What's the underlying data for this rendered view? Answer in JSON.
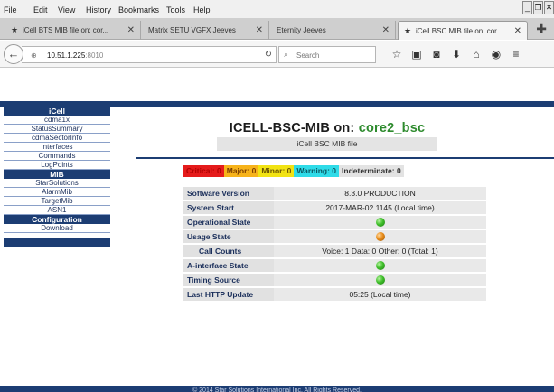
{
  "browser": {
    "menu": [
      "File",
      "Edit",
      "View",
      "History",
      "Bookmarks",
      "Tools",
      "Help"
    ],
    "tabs": [
      {
        "label": "iCell BTS MIB file on: cor..."
      },
      {
        "label": "Matrix SETU VGFX Jeeves"
      },
      {
        "label": "Eternity Jeeves"
      },
      {
        "label": "iCell BSC MIB file on: cor..."
      }
    ],
    "url_host": "10.51.1.225",
    "url_port": ":8010",
    "search_placeholder": "Search"
  },
  "sidebar": {
    "sections": [
      {
        "header": "iCell",
        "items": [
          "cdma1x",
          "StatusSummary",
          "cdmaSectorInfo",
          "Interfaces",
          "Commands",
          "LogPoints"
        ]
      },
      {
        "header": "MIB",
        "items": [
          "StarSolutions",
          "AlarmMib",
          "TargetMib",
          "ASN1"
        ]
      },
      {
        "header": "Configuration",
        "items": [
          "Download"
        ]
      }
    ]
  },
  "page": {
    "title_prefix": "ICELL-BSC-MIB on:",
    "title_host": "core2_bsc",
    "subtitle": "iCell BSC MIB file"
  },
  "alarms": {
    "critical": "Critical: 0",
    "major": "Major: 0",
    "minor": "Minor: 0",
    "warning": "Warning: 0",
    "indeterminate": "Indeterminate: 0"
  },
  "status_rows": [
    {
      "label": "Software Version",
      "value": "8.3.0 PRODUCTION"
    },
    {
      "label": "System Start",
      "value": "2017-MAR-02.1145 (Local time)"
    },
    {
      "label": "Operational State",
      "indicator": "green"
    },
    {
      "label": "Usage State",
      "indicator": "orange"
    },
    {
      "label": "Call Counts",
      "value": "Voice: 1 Data: 0 Other: 0 (Total: 1)",
      "indent": true
    },
    {
      "label": "A-interface State",
      "indicator": "green"
    },
    {
      "label": "Timing Source",
      "indicator": "green"
    },
    {
      "label": "Last HTTP Update",
      "value": "05:25 (Local time)"
    }
  ],
  "footer": "© 2014 Star Solutions International Inc. All Rights Reserved."
}
